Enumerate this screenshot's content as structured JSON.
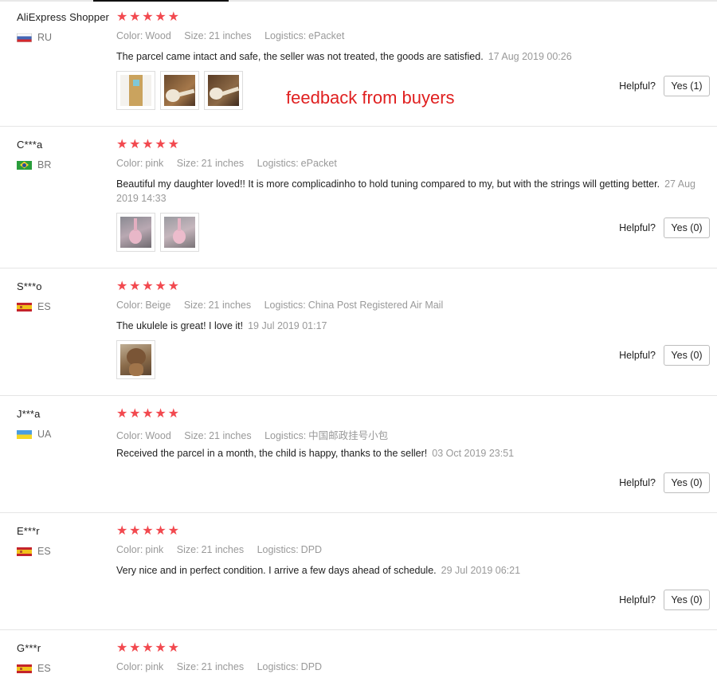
{
  "overlay_text": "feedback from buyers",
  "helpful_label": "Helpful?",
  "star_glyphs": "★★★★★",
  "attr_labels": {
    "color": "Color:",
    "size": "Size:",
    "logistics": "Logistics:"
  },
  "colors": {
    "star": "#f2494f",
    "overlay": "#e02020",
    "muted": "#999999"
  },
  "reviews": [
    {
      "user": "AliExpress Shopper",
      "country": "RU",
      "flag": "ru",
      "rating": 5,
      "color": "Wood",
      "size": "21 inches",
      "logistics": "ePacket",
      "comment": "The parcel came intact and safe, the seller was not treated, the goods are satisfied.",
      "date": "17 Aug 2019 00:26",
      "photos": 3,
      "helpful_yes": "Yes (1)"
    },
    {
      "user": "C***a",
      "country": "BR",
      "flag": "br",
      "rating": 5,
      "color": "pink",
      "size": "21 inches",
      "logistics": "ePacket",
      "comment": "Beautiful my daughter loved!! It is more complicadinho to hold tuning compared to my, but with the strings will getting better.",
      "date": "27 Aug 2019 14:33",
      "photos": 2,
      "helpful_yes": "Yes (0)"
    },
    {
      "user": "S***o",
      "country": "ES",
      "flag": "es",
      "rating": 5,
      "color": "Beige",
      "size": "21 inches",
      "logistics": "China Post Registered Air Mail",
      "comment": "The ukulele is great! I love it!",
      "date": "19 Jul 2019 01:17",
      "photos": 1,
      "helpful_yes": "Yes (0)"
    },
    {
      "user": "J***a",
      "country": "UA",
      "flag": "ua",
      "rating": 5,
      "color": "Wood",
      "size": "21 inches",
      "logistics": "中国邮政挂号小包",
      "comment": "Received the parcel in a month, the child is happy, thanks to the seller!",
      "date": "03 Oct 2019 23:51",
      "photos": 0,
      "helpful_yes": "Yes (0)"
    },
    {
      "user": "E***r",
      "country": "ES",
      "flag": "es",
      "rating": 5,
      "color": "pink",
      "size": "21 inches",
      "logistics": "DPD",
      "comment": "Very nice and in perfect condition. I arrive a few days ahead of schedule.",
      "date": "29 Jul 2019 06:21",
      "photos": 0,
      "helpful_yes": "Yes (0)"
    },
    {
      "user": "G***r",
      "country": "ES",
      "flag": "es",
      "rating": 5,
      "color": "pink",
      "size": "21 inches",
      "logistics": "DPD",
      "comment": "",
      "date": "",
      "photos": 0,
      "helpful_yes": ""
    }
  ]
}
